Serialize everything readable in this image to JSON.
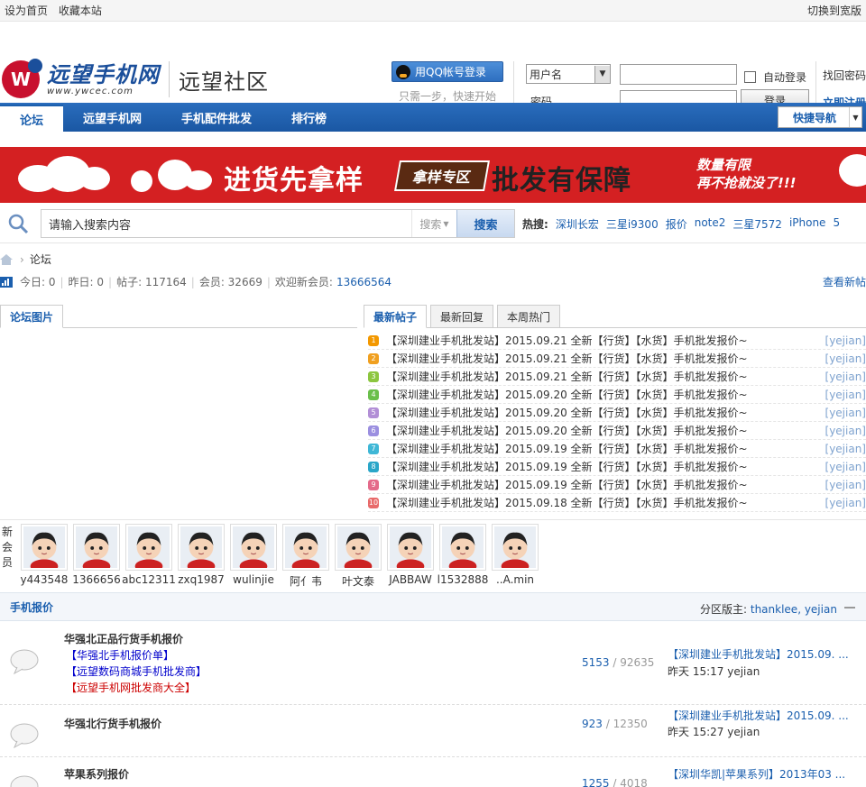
{
  "topbar": {
    "set_home": "设为首页",
    "bookmark": "收藏本站",
    "switch_wide": "切换到宽版"
  },
  "logo": {
    "mark": "W",
    "cn": "远望手机网",
    "url": "www.ywcec.com",
    "sub": "远望社区"
  },
  "login": {
    "qq_button": "用QQ帐号登录",
    "qq_hint": "只需一步，快速开始",
    "username_type": "用户名",
    "password_label": "密码",
    "auto_login": "自动登录",
    "login_button": "登录",
    "find_password": "找回密码",
    "register": "立即注册"
  },
  "nav": {
    "items": [
      "论坛",
      "远望手机网",
      "手机配件批发",
      "排行榜"
    ],
    "quick_nav": "快捷导航"
  },
  "banner": {
    "t1a": "进货先",
    "t1b": "拿样",
    "tag": "拿样专区",
    "t2": "批发有保障",
    "t3a": "数量有限",
    "t3b": "再不抢就没了!!!"
  },
  "search": {
    "placeholder": "请输入搜索内容",
    "type": "搜索",
    "button": "搜索",
    "hot_label": "热搜:",
    "hot": [
      "深圳长宏",
      "三星i9300",
      "报价",
      "note2",
      "三星7572",
      "iPhone",
      "5"
    ]
  },
  "breadcrumb": {
    "current": "论坛"
  },
  "stats": {
    "today": "今日: 0",
    "yesterday": "昨日: 0",
    "posts": "帖子: 117164",
    "members": "会员: 32669",
    "welcome": "欢迎新会员:",
    "new_member": "13666564",
    "view_new": "查看新帖"
  },
  "pic_tab": "论坛图片",
  "post_tabs": [
    "最新帖子",
    "最新回复",
    "本周热门"
  ],
  "posts": [
    {
      "n": "1",
      "color": "#f39800",
      "title": "【深圳建业手机批发站】2015.09.21 全新【行货】【水货】手机批发报价~",
      "author": "[yejian]"
    },
    {
      "n": "2",
      "color": "#f0a020",
      "title": "【深圳建业手机批发站】2015.09.21 全新【行货】【水货】手机批发报价~",
      "author": "[yejian]"
    },
    {
      "n": "3",
      "color": "#8cc63f",
      "title": "【深圳建业手机批发站】2015.09.21 全新【行货】【水货】手机批发报价~",
      "author": "[yejian]"
    },
    {
      "n": "4",
      "color": "#6abf4b",
      "title": "【深圳建业手机批发站】2015.09.20 全新【行货】【水货】手机批发报价~",
      "author": "[yejian]"
    },
    {
      "n": "5",
      "color": "#b28fd6",
      "title": "【深圳建业手机批发站】2015.09.20 全新【行货】【水货】手机批发报价~",
      "author": "[yejian]"
    },
    {
      "n": "6",
      "color": "#9b8fe0",
      "title": "【深圳建业手机批发站】2015.09.20 全新【行货】【水货】手机批发报价~",
      "author": "[yejian]"
    },
    {
      "n": "7",
      "color": "#3fb7d6",
      "title": "【深圳建业手机批发站】2015.09.19 全新【行货】【水货】手机批发报价~",
      "author": "[yejian]"
    },
    {
      "n": "8",
      "color": "#2aa6c8",
      "title": "【深圳建业手机批发站】2015.09.19 全新【行货】【水货】手机批发报价~",
      "author": "[yejian]"
    },
    {
      "n": "9",
      "color": "#e46a8a",
      "title": "【深圳建业手机批发站】2015.09.19 全新【行货】【水货】手机批发报价~",
      "author": "[yejian]"
    },
    {
      "n": "10",
      "color": "#e86a6a",
      "title": "【深圳建业手机批发站】2015.09.18 全新【行货】【水货】手机批发报价~",
      "author": "[yejian]"
    }
  ],
  "members_label": "新会员",
  "members": [
    "y443548",
    "1366656",
    "abc12311",
    "zxq1987",
    "wulinjie",
    "阿亻韦",
    "叶文泰",
    "JABBAW",
    "l1532888",
    "..A.min"
  ],
  "section": {
    "title": "手机报价",
    "mods_label": "分区版主:",
    "mods": "thanklee, yejian"
  },
  "forums": [
    {
      "name": "华强北正品行货手机报价",
      "subs": [
        {
          "text": "【华强北手机报价单】",
          "color": "#0000cc"
        },
        {
          "text": "【远望数码商城手机批发商】",
          "color": "#0000cc"
        },
        {
          "text": "【远望手机网批发商大全】",
          "color": "#cc0000"
        }
      ],
      "threads": "5153",
      "posts": "92635",
      "last": "【深圳建业手机批发站】2015.09. ...",
      "when": "昨天 15:17 yejian"
    },
    {
      "name": "华强北行货手机报价",
      "subs": [],
      "threads": "923",
      "posts": "12350",
      "last": "【深圳建业手机批发站】2015.09. ...",
      "when": "昨天 15:27 yejian"
    },
    {
      "name": "苹果系列报价",
      "subs": [],
      "threads": "1255",
      "posts": "4018",
      "last": "【深圳华凯|苹果系列】2013年03 ...",
      "when": ""
    }
  ]
}
